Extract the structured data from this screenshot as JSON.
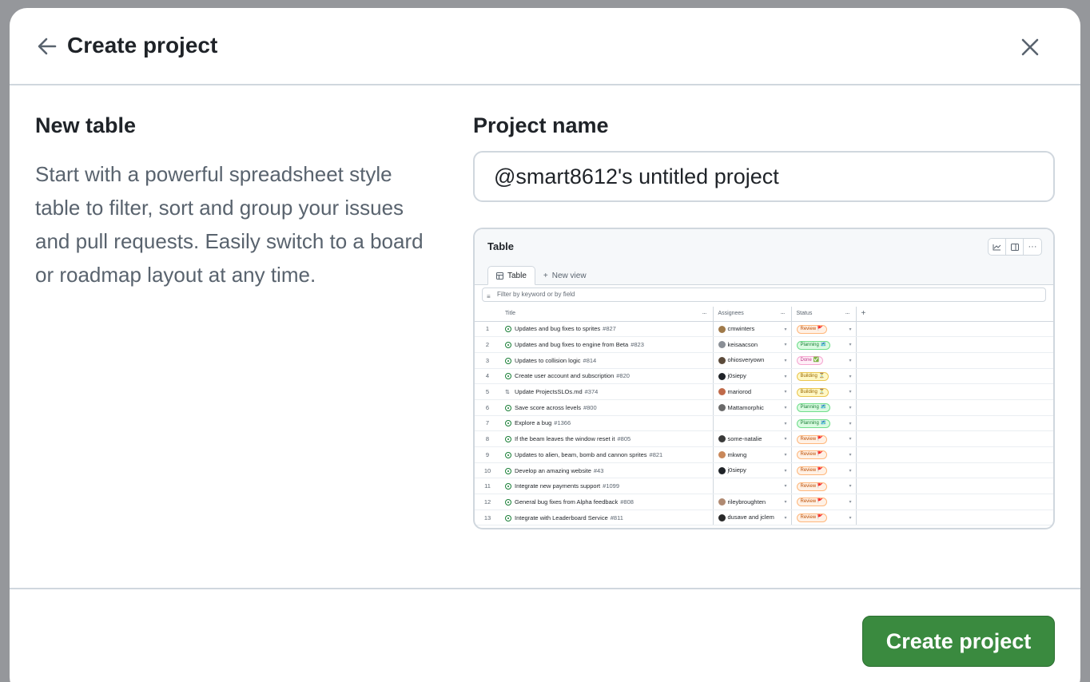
{
  "dialog": {
    "title": "Create project",
    "back_icon": "arrow-left-icon",
    "close_icon": "close-icon"
  },
  "template": {
    "heading": "New table",
    "description": "Start with a powerful spreadsheet style table to filter, sort and group your issues and pull requests. Easily switch to a board or roadmap layout at any time."
  },
  "project_name": {
    "label": "Project name",
    "value": "@smart8612's untitled project"
  },
  "preview": {
    "title": "Table",
    "tabs": [
      {
        "label": "Table",
        "icon": "table-icon"
      },
      {
        "label": "New view",
        "icon": "plus-icon"
      }
    ],
    "filter_placeholder": "Filter by keyword or by field",
    "columns": [
      "Title",
      "Assignees",
      "Status"
    ],
    "rows": [
      {
        "n": "1",
        "type": "issue",
        "title": "Updates and bug fixes to sprites",
        "ref": "#827",
        "assignee": "cmwinters",
        "status": "Review 🚩",
        "kind": "review",
        "avatar": "#a07a4a"
      },
      {
        "n": "2",
        "type": "issue",
        "title": "Updates and bug fixes to engine from Beta",
        "ref": "#823",
        "assignee": "keisaacson",
        "status": "Planning 🗺️",
        "kind": "planning",
        "avatar": "#8a8f96"
      },
      {
        "n": "3",
        "type": "issue",
        "title": "Updates to collision logic",
        "ref": "#814",
        "assignee": "ohiosveryown",
        "status": "Done ✅",
        "kind": "done",
        "avatar": "#5b4a3a"
      },
      {
        "n": "4",
        "type": "issue",
        "title": "Create user account and subscription",
        "ref": "#820",
        "assignee": "j0siepy",
        "status": "Building ⏳",
        "kind": "building",
        "avatar": "#1f2328"
      },
      {
        "n": "5",
        "type": "pr",
        "title": "Update ProjectsSLOs.md",
        "ref": "#374",
        "assignee": "mariorod",
        "status": "Building ⏳",
        "kind": "building",
        "avatar": "#c06a4a"
      },
      {
        "n": "6",
        "type": "issue",
        "title": "Save score across levels",
        "ref": "#800",
        "assignee": "Mattamorphic",
        "status": "Planning 🗺️",
        "kind": "planning",
        "avatar": "#6a6a6a"
      },
      {
        "n": "7",
        "type": "issue",
        "title": "Explore a bug",
        "ref": "#1366",
        "assignee": "",
        "status": "Planning 🗺️",
        "kind": "planning",
        "avatar": ""
      },
      {
        "n": "8",
        "type": "issue",
        "title": "If the beam leaves the window reset it",
        "ref": "#805",
        "assignee": "some-natalie",
        "status": "Review 🚩",
        "kind": "review",
        "avatar": "#3a3a3a"
      },
      {
        "n": "9",
        "type": "issue",
        "title": "Updates to alien, beam, bomb and cannon sprites",
        "ref": "#821",
        "assignee": "mkwng",
        "status": "Review 🚩",
        "kind": "review",
        "avatar": "#c9885a"
      },
      {
        "n": "10",
        "type": "issue",
        "title": "Develop an amazing website",
        "ref": "#43",
        "assignee": "j0siepy",
        "status": "Review 🚩",
        "kind": "review",
        "avatar": "#1f2328"
      },
      {
        "n": "11",
        "type": "issue",
        "title": "Integrate new payments support",
        "ref": "#1099",
        "assignee": "",
        "status": "Review 🚩",
        "kind": "review",
        "avatar": ""
      },
      {
        "n": "12",
        "type": "issue",
        "title": "General bug fixes from Alpha feedback",
        "ref": "#808",
        "assignee": "rileybroughten",
        "status": "Review 🚩",
        "kind": "review",
        "avatar": "#b08a72"
      },
      {
        "n": "13",
        "type": "issue",
        "title": "Integrate with Leaderboard Service",
        "ref": "#811",
        "assignee": "dusave and jclem",
        "status": "Review 🚩",
        "kind": "review",
        "avatar": "#2a2a2a"
      }
    ]
  },
  "footer": {
    "create_label": "Create project"
  }
}
